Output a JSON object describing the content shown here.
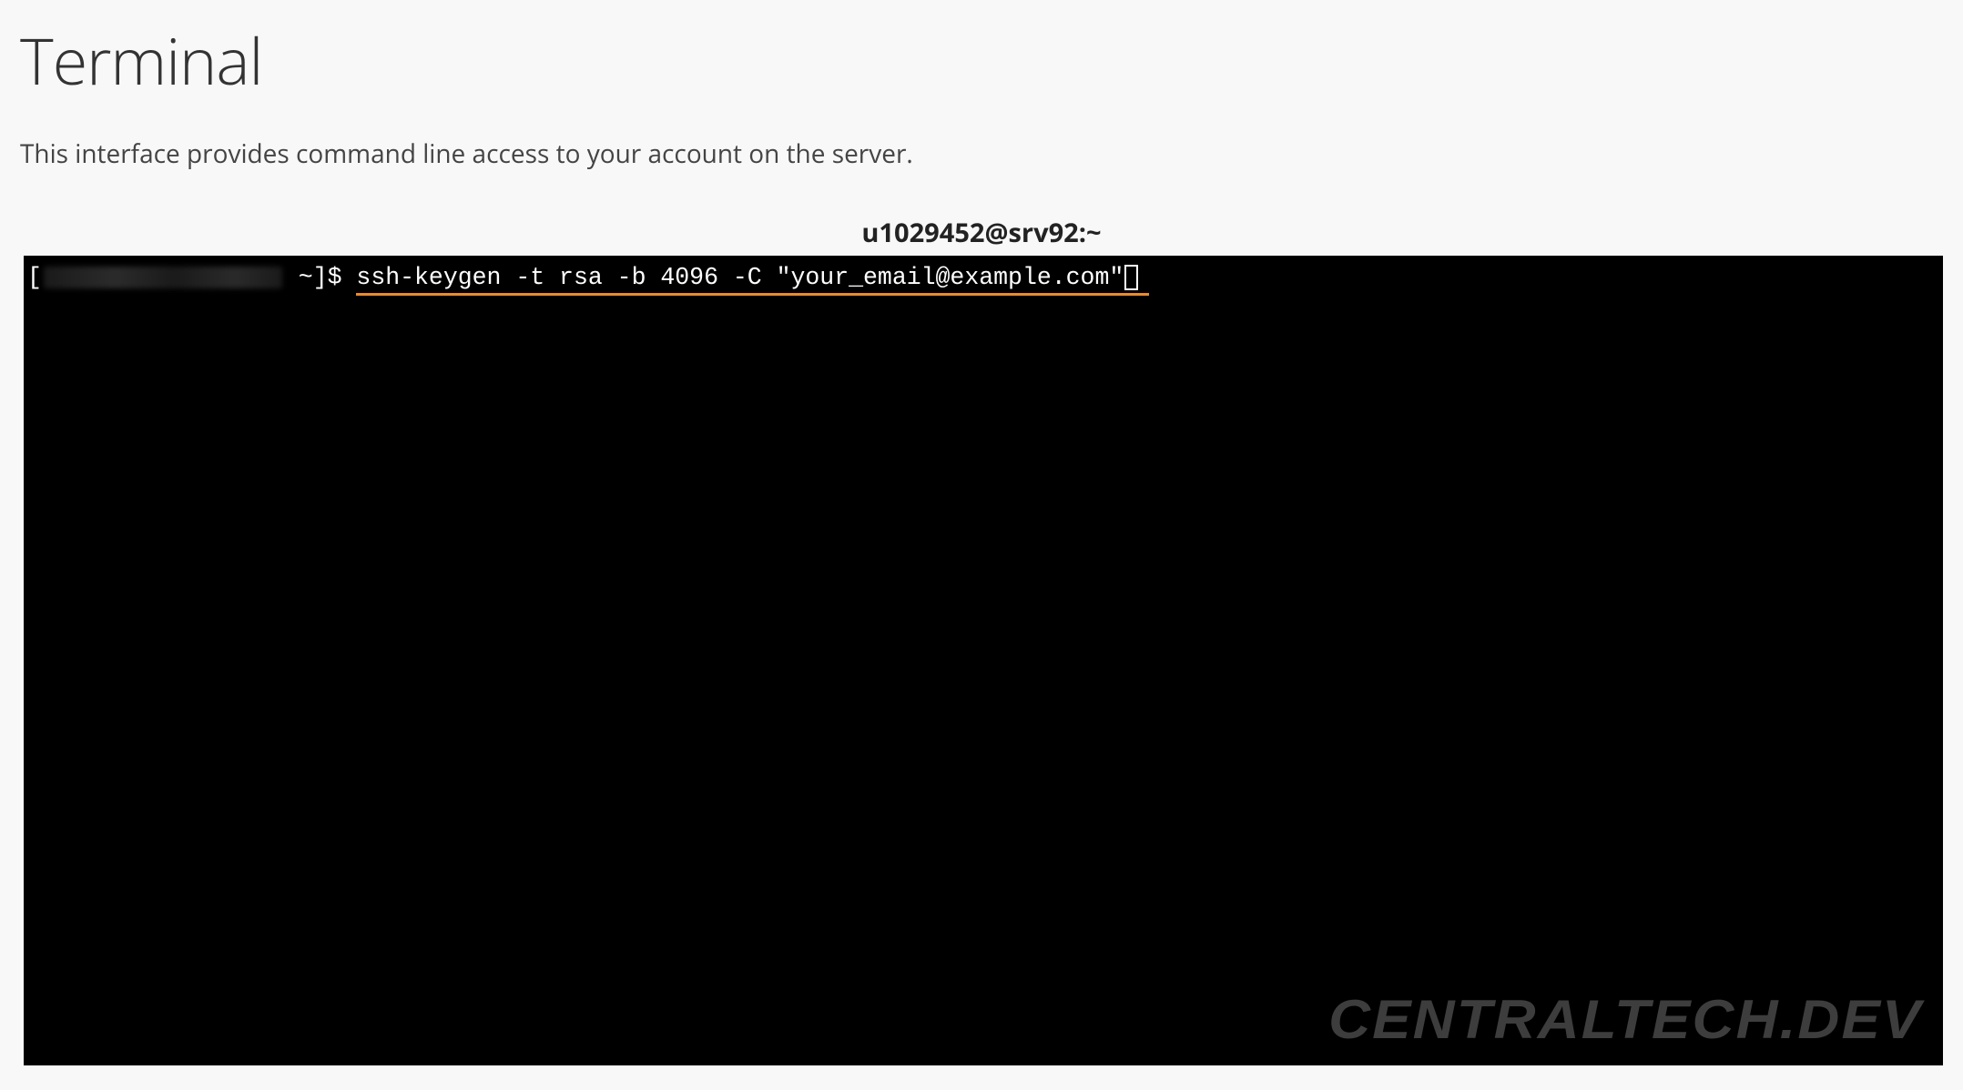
{
  "header": {
    "title": "Terminal",
    "subtitle": "This interface provides command line access to your account on the server."
  },
  "session": {
    "label": "u1029452@srv92:~"
  },
  "terminal": {
    "prompt_open": "[",
    "prompt_suffix": " ~]$ ",
    "command": "ssh-keygen -t rsa -b 4096 -C \"your_email@example.com\"",
    "underline_color": "#e88b2e"
  },
  "watermark": {
    "text": "CENTRALTECH.DEV"
  }
}
